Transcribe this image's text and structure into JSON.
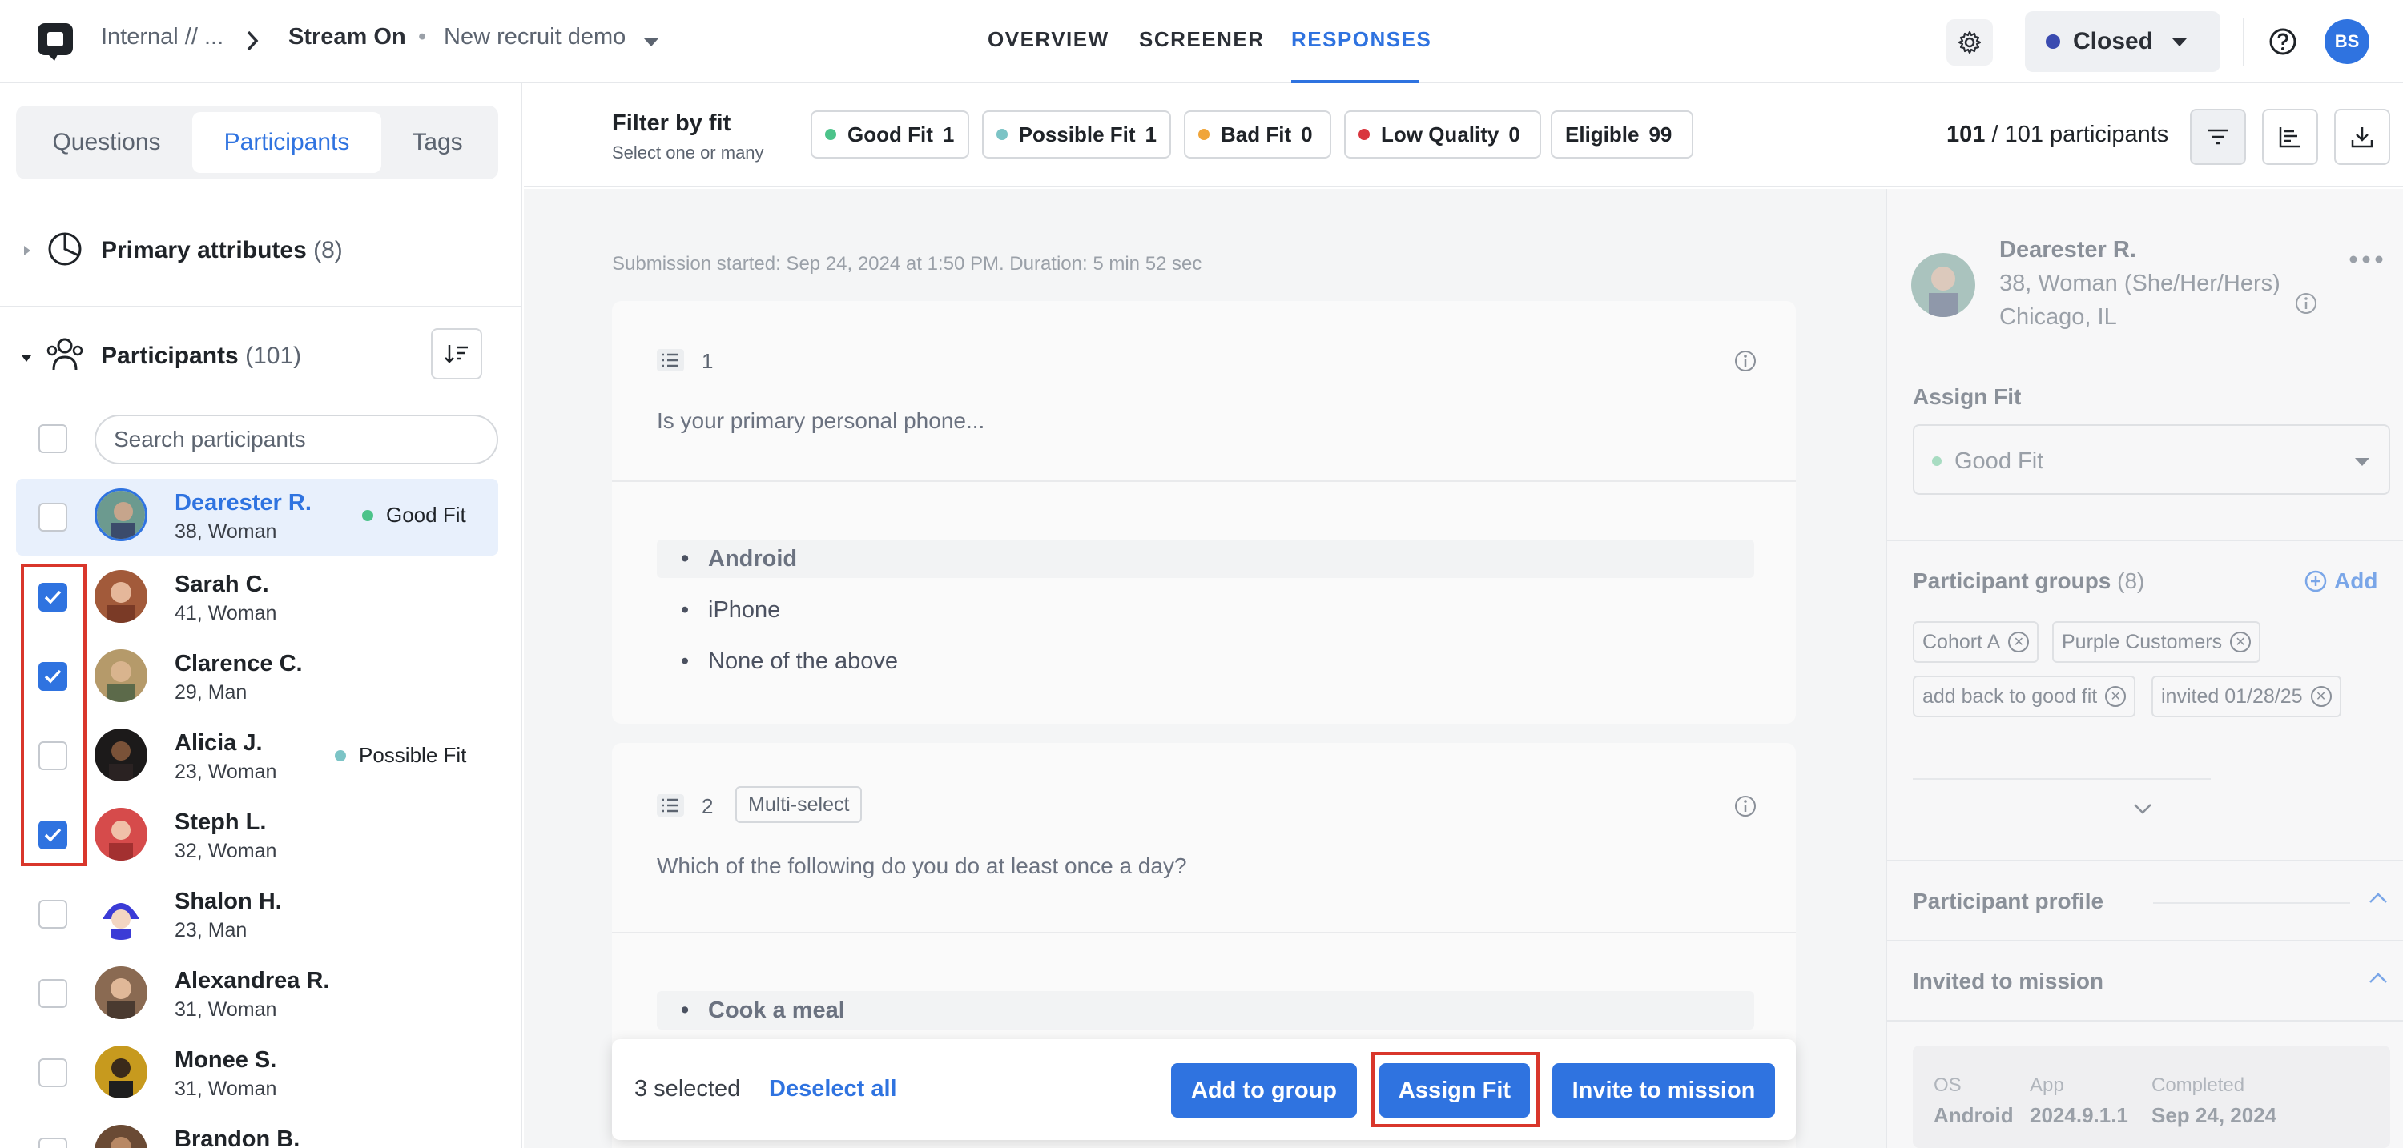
{
  "header": {
    "breadcrumb_workspace": "Internal // ...",
    "breadcrumb_project": "Stream On",
    "breadcrumb_separator": "•",
    "breadcrumb_study": "New recruit demo",
    "tabs": [
      {
        "label": "OVERVIEW"
      },
      {
        "label": "SCREENER"
      },
      {
        "label": "RESPONSES"
      }
    ],
    "status_label": "Closed",
    "status_color": "#3a4bb0",
    "avatar_initials": "BS",
    "accent_color": "#2f73e0"
  },
  "sidebar": {
    "tabs": [
      {
        "label": "Questions"
      },
      {
        "label": "Participants"
      },
      {
        "label": "Tags"
      }
    ],
    "primary_attributes": {
      "label": "Primary attributes",
      "count": "(8)"
    },
    "participants_section": {
      "label": "Participants",
      "count": "(101)"
    },
    "search_placeholder": "Search participants",
    "participants": [
      {
        "name": "Dearester R.",
        "meta": "38, Woman",
        "fit": "Good Fit",
        "fit_color": "#4cc38a",
        "checked": false,
        "active": true
      },
      {
        "name": "Sarah C.",
        "meta": "41, Woman",
        "fit": "",
        "checked": true
      },
      {
        "name": "Clarence C.",
        "meta": "29, Man",
        "fit": "",
        "checked": true
      },
      {
        "name": "Alicia J.",
        "meta": "23, Woman",
        "fit": "Possible Fit",
        "fit_color": "#7cc4c6",
        "checked": false
      },
      {
        "name": "Steph L.",
        "meta": "32, Woman",
        "fit": "",
        "checked": true
      },
      {
        "name": "Shalon H.",
        "meta": "23, Man",
        "fit": "",
        "checked": false
      },
      {
        "name": "Alexandrea R.",
        "meta": "31, Woman",
        "fit": "",
        "checked": false
      },
      {
        "name": "Monee S.",
        "meta": "31, Woman",
        "fit": "",
        "checked": false
      },
      {
        "name": "Brandon B.",
        "meta": "",
        "fit": "",
        "checked": false
      }
    ]
  },
  "filter": {
    "title": "Filter by fit",
    "subtitle": "Select one or many",
    "chips": [
      {
        "label": "Good Fit",
        "count": "1",
        "color": "#4cc38a"
      },
      {
        "label": "Possible Fit",
        "count": "1",
        "color": "#7cc4c6"
      },
      {
        "label": "Bad Fit",
        "count": "0",
        "color": "#f0a53a"
      },
      {
        "label": "Low Quality",
        "count": "0",
        "color": "#d9363e"
      },
      {
        "label": "Eligible",
        "count": "99"
      }
    ],
    "count_bold": "101",
    "count_rest": "/ 101 participants"
  },
  "response": {
    "submission_info": "Submission started: Sep 24, 2024 at 1:50 PM. Duration: 5 min 52 sec",
    "questions": [
      {
        "number": "1",
        "type": "",
        "text": "Is your primary personal phone...",
        "options": [
          "Android",
          "iPhone",
          "None of the above"
        ],
        "selected": "Android"
      },
      {
        "number": "2",
        "type": "Multi-select",
        "text": "Which of the following do you do at least once a day?",
        "options": [
          "Cook a meal"
        ],
        "selected": "Cook a meal"
      }
    ]
  },
  "action_bar": {
    "selected_text": "3 selected",
    "deselect_label": "Deselect all",
    "add_group_label": "Add to group",
    "assign_fit_label": "Assign Fit",
    "invite_label": "Invite to mission"
  },
  "detail": {
    "name": "Dearester R.",
    "meta": "38, Woman (She/Her/Hers)",
    "location": "Chicago, IL",
    "assign_fit_label": "Assign Fit",
    "assign_fit_value": "Good Fit",
    "groups_label": "Participant groups",
    "groups_count": "(8)",
    "add_label": "Add",
    "groups": [
      "Cohort A",
      "Purple Customers",
      "add back to good fit",
      "invited 01/28/25"
    ],
    "profile_label": "Participant profile",
    "invited_label": "Invited to mission",
    "mission": {
      "os_label": "OS",
      "os_value": "Android",
      "app_label": "App",
      "app_value": "2024.9.1.1",
      "completed_label": "Completed",
      "completed_value": "Sep 24, 2024"
    }
  }
}
